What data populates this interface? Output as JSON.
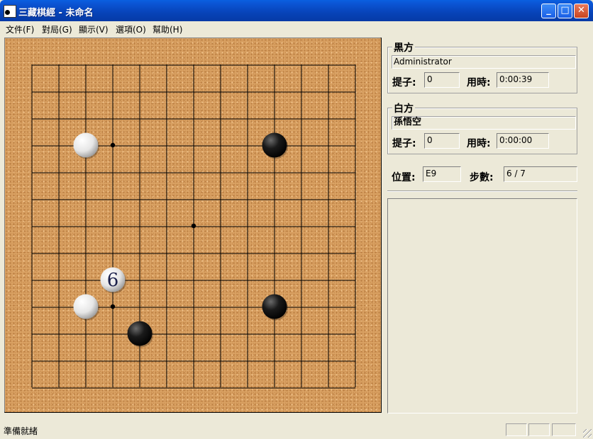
{
  "window": {
    "title": "三藏棋經 - 未命名",
    "controls": {
      "minimize": "_",
      "maximize": "□",
      "close": "✕"
    }
  },
  "menu": [
    "文件(F)",
    "對局(G)",
    "顯示(V)",
    "選項(O)",
    "幫助(H)"
  ],
  "black": {
    "group_title": "黒方",
    "name": "Administrator",
    "captures_label": "提子:",
    "captures": "0",
    "time_label": "用時:",
    "time": "0:00:39"
  },
  "white": {
    "group_title": "白方",
    "name": "孫悟空",
    "captures_label": "提子:",
    "captures": "0",
    "time_label": "用時:",
    "time": "0:00:00"
  },
  "position_label": "位置:",
  "position": "E9",
  "moves_label": "步數:",
  "moves": "6 / 7",
  "status": "準備就緒",
  "board": {
    "size": 13,
    "star_points": [
      [
        3,
        3
      ],
      [
        6,
        6
      ],
      [
        3,
        9
      ]
    ],
    "stones": [
      {
        "color": "white",
        "col": 2,
        "row": 3
      },
      {
        "color": "black",
        "col": 9,
        "row": 3
      },
      {
        "color": "white",
        "col": 3,
        "row": 8,
        "label": "6"
      },
      {
        "color": "white",
        "col": 2,
        "row": 9
      },
      {
        "color": "black",
        "col": 9,
        "row": 9
      },
      {
        "color": "black",
        "col": 4,
        "row": 10
      }
    ]
  },
  "colors": {
    "board": "#daa263",
    "titlebar": "#0743b8"
  }
}
